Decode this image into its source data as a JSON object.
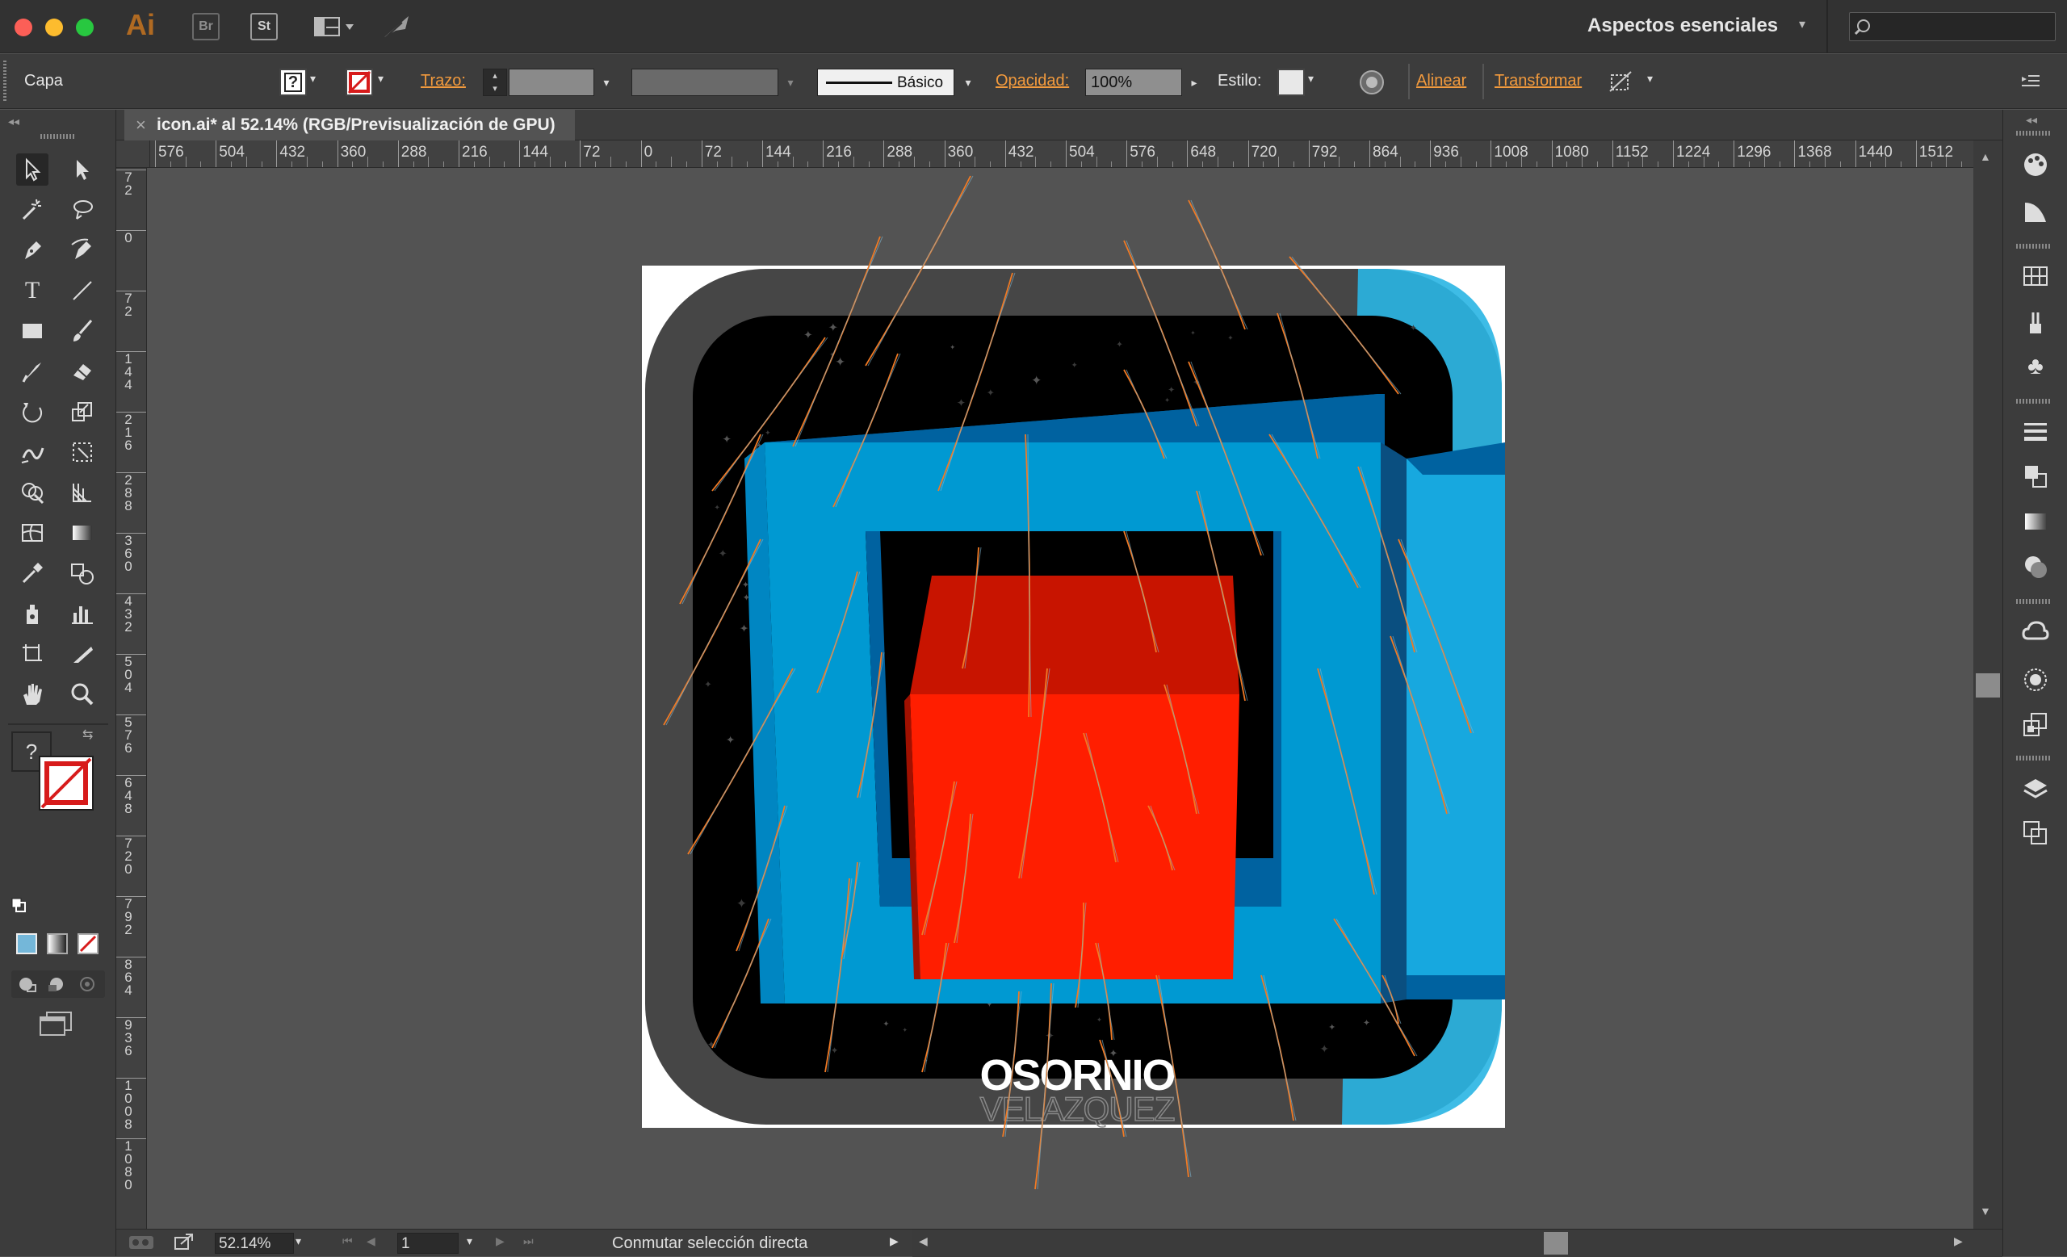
{
  "titlebar": {
    "app_logo": "Ai",
    "bridge_label": "Br",
    "stock_label": "St",
    "workspace": "Aspectos esenciales",
    "search_placeholder": ""
  },
  "control_bar": {
    "selection_label": "Capa",
    "fill_label": "?",
    "stroke_label": "Trazo:",
    "brush_label": "Básico",
    "opacity_label": "Opacidad:",
    "opacity_value": "100%",
    "style_label": "Estilo:",
    "align_label": "Alinear",
    "transform_label": "Transformar"
  },
  "document": {
    "tab_title": "icon.ai* al 52.14% (RGB/Previsualización de GPU)",
    "close_symbol": "×"
  },
  "rulers": {
    "horizontal": [
      "576",
      "504",
      "432",
      "360",
      "288",
      "216",
      "144",
      "72",
      "0",
      "72",
      "144",
      "216",
      "288",
      "360",
      "432",
      "504",
      "576",
      "648",
      "720",
      "792",
      "864",
      "936",
      "1008",
      "1080",
      "1152",
      "1224",
      "1296",
      "1368",
      "1440",
      "1512"
    ],
    "vertical": [
      "72",
      "0",
      "72",
      "144",
      "216",
      "288",
      "360",
      "432",
      "504",
      "576",
      "648",
      "720",
      "792",
      "864",
      "936",
      "1008",
      "1080"
    ]
  },
  "artwork": {
    "title_top": "OSORNIO",
    "title_bottom": "VELAZQUEZ",
    "colors": {
      "blue_face": "#0099d2",
      "blue_shadow": "#0062a0",
      "blue_light": "#29b5e3",
      "red_front": "#ff1e00",
      "red_top": "#c81400",
      "black": "#000000",
      "grey_frame": "#464646",
      "orange_line": "#f07a25"
    }
  },
  "status_bar": {
    "zoom": "52.14%",
    "artboard_number": "1",
    "status_text": "Conmutar selección directa"
  },
  "tools_panel": {
    "fill_placeholder": "?"
  }
}
